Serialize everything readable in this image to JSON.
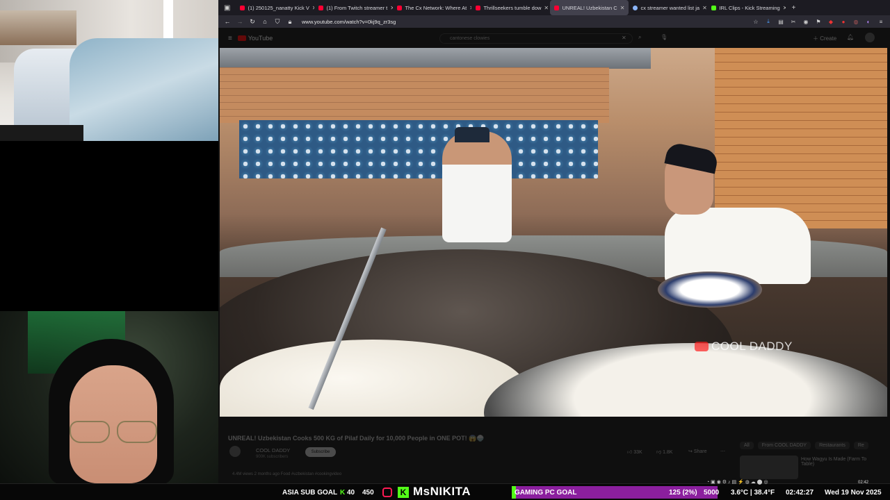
{
  "browser": {
    "tabs": [
      {
        "label": "(1) 250125_nanatty Kick V",
        "favicon": "youtube"
      },
      {
        "label": "(1) From Twitch streamer t",
        "favicon": "youtube"
      },
      {
        "label": "The Cx Network: Where At",
        "favicon": "youtube"
      },
      {
        "label": "Thrillseekers tumble dow",
        "favicon": "youtube"
      },
      {
        "label": "UNREAL! Uzbekistan C",
        "favicon": "youtube",
        "active": true
      },
      {
        "label": "cx streamer wanted list ja",
        "favicon": "google"
      },
      {
        "label": "IRL Clips - Kick Streaming",
        "favicon": "kick"
      }
    ],
    "new_tab": "+",
    "url": "www.youtube.com/watch?v=0kj9q_zr3sg"
  },
  "youtube": {
    "logo": "YouTube",
    "search_text": "cantonese clowies",
    "create_label": "Create",
    "video_title": "UNREAL! Uzbekistan Cooks 500 KG of Pilaf Daily for 10,000 People in ONE POT! 😱🍚",
    "channel_name": "COOL DADDY",
    "channel_subs": "900K subscribers",
    "subscribe_label": "Subscribe",
    "likes": "33K",
    "dislike_label": "1.8K",
    "share_label": "Share",
    "views_line": "4.4M views  2 months ago  Food #uzbekistan #cookingvideo",
    "watermark": "COOL DADDY",
    "chips": [
      "All",
      "From COOL DADDY",
      "Restaurants",
      "Re"
    ],
    "side_video_title": "How Wagyu Is Made (Farm To Table)"
  },
  "overlay": {
    "sub_goal_label": "ASIA SUB GOAL",
    "sub_goal_current": "40",
    "sub_goal_target": "450",
    "streamer_name": "MsNIKITA",
    "pc_goal_label": "GAMING PC GOAL",
    "pc_goal_progress": "125 (2%)",
    "pc_goal_progress_fraction": 0.02,
    "pc_goal_target": "5000",
    "weather": "3.6°C | 38.4°F",
    "time": "02:42:27",
    "date": "Wed 19 Nov 2025",
    "tray_clock": "02:42",
    "kick_color": "#53fc18",
    "goal_bar_color": "#8b1f9e"
  }
}
